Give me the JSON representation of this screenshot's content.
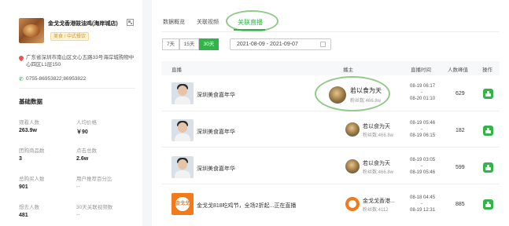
{
  "shop": {
    "name": "金戈戈香港豉油鸡(海岸城店)",
    "tag": "美食 / 中式餐饮",
    "address": "广东省深圳市南山区文心五路33号海岸城购物中心四区L1层150",
    "phone": "0755-86953822;86953822",
    "icons": {
      "address": "location-pin-icon",
      "phone": "phone-icon",
      "qr": "qr-code-icon"
    }
  },
  "basic_data": {
    "title": "基础数据",
    "stats": [
      {
        "label": "观看人数",
        "value": "263.9w"
      },
      {
        "label": "人均价格",
        "value": "￥90"
      },
      {
        "label": "团购商品数",
        "value": "3"
      },
      {
        "label": "点击总数",
        "value": "2.6w"
      },
      {
        "label": "总购买人数",
        "value": "901"
      },
      {
        "label": "用户推荐百分比",
        "value": "--"
      },
      {
        "label": "想去人数",
        "value": "481"
      },
      {
        "label": "30天关联视频数",
        "value": "--"
      }
    ]
  },
  "tabs": [
    {
      "label": "数据概览"
    },
    {
      "label": "关联视频"
    },
    {
      "label": "关联直播"
    }
  ],
  "filters": {
    "ranges": [
      "7天",
      "15天",
      "30天"
    ],
    "active_range": "30天",
    "date_range": "2021-08-09  -  2021-09-07"
  },
  "table": {
    "headers": [
      "直播",
      "播主",
      "直播时间",
      "人数峰值",
      "操作"
    ],
    "rows": [
      {
        "live_title": "深圳美食嘉年华",
        "anchor": "若以食为天",
        "fans": "粉丝数:466.8w",
        "start": "08-19 06:17",
        "end": "08-20 01:10",
        "peak": "629"
      },
      {
        "live_title": "深圳美食嘉年华",
        "anchor": "若以食为天",
        "fans": "粉丝数:466.8w",
        "start": "08-19 05:46",
        "end": "08-19 06:15",
        "peak": "182"
      },
      {
        "live_title": "深圳美食嘉年华",
        "anchor": "若以食为天",
        "fans": "粉丝数:466.8w",
        "start": "08-19 03:05",
        "end": "08-19 05:46",
        "peak": "599"
      },
      {
        "live_title": "金戈戈818吃鸡节，全场2折起...正在直播",
        "anchor": "金戈戈香港...",
        "fans": "粉丝数:4112",
        "start": "08-18 04:45",
        "end": "08-19 12:31",
        "peak": "885"
      }
    ],
    "time_separator": "-",
    "thumb_logo_text": "金戈戈",
    "action_icon": "stats-icon"
  },
  "highlight": {
    "anchor": "若以食为天",
    "fans": "粉丝数:466.8w"
  }
}
